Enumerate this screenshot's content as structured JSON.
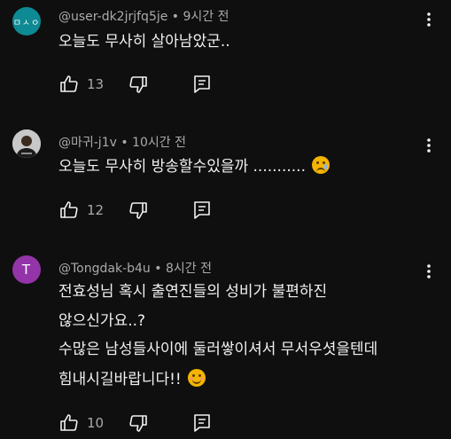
{
  "colors": {
    "background": "#0f0f0f",
    "text": "#f1f1f1",
    "meta_text": "#aaaaaa",
    "icon": "#f1f1f1",
    "avatar_teal": "#0d8a93",
    "avatar_purple": "#9334a8"
  },
  "comments": [
    {
      "avatar_text": "ㅁㅅㅇ",
      "avatar_color": "#0d8a93",
      "meta": "@user-dk2jrjfq5je • 9시간 전",
      "lines": [
        "오늘도 무사히 살아남았군.."
      ],
      "likes": "13",
      "icons": [
        "thumb-up-icon",
        "thumb-down-icon",
        "reply-icon",
        "more-vertical-icon"
      ]
    },
    {
      "avatar_text": "",
      "avatar_color": "#b9b9b9",
      "meta": "@마귀-j1v • 10시간 전",
      "lines": [
        "오늘도 무사히 방송할수있을까 ..........."
      ],
      "emoji_after_line": "crying-face-emoji",
      "likes": "12",
      "icons": [
        "thumb-up-icon",
        "thumb-down-icon",
        "reply-icon",
        "more-vertical-icon"
      ]
    },
    {
      "avatar_text": "T",
      "avatar_color": "#9334a8",
      "meta": "@Tongdak-b4u • 8시간 전",
      "lines": [
        "전효성님 혹시 출연진들의 성비가 불편하진",
        "않으신가요..?",
        "수많은 남성들사이에 둘러쌓이셔서 무서우셧을텐데",
        "힘내시길바랍니다!!"
      ],
      "emoji_after_line": "smiling-face-emoji",
      "likes": "10",
      "icons": [
        "thumb-up-icon",
        "thumb-down-icon",
        "reply-icon",
        "more-vertical-icon"
      ]
    }
  ]
}
